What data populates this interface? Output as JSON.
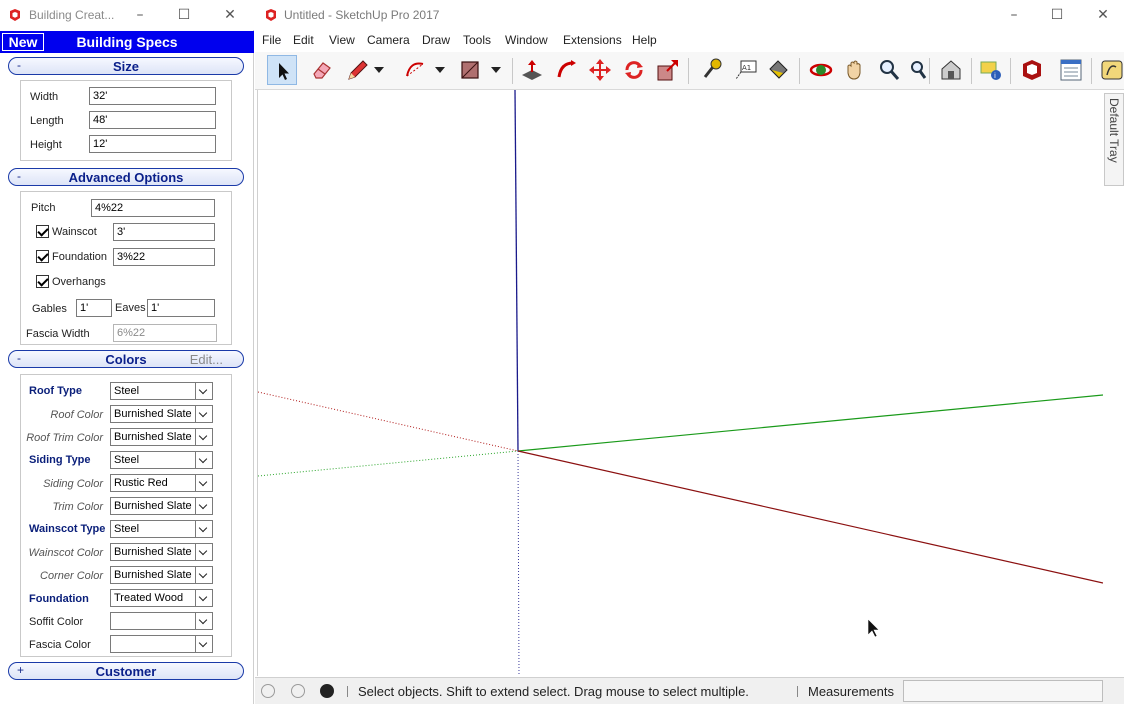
{
  "left_window": {
    "title": "Building Creat...",
    "new_button": "New",
    "header_title": "Building Specs",
    "size_section": {
      "toggle": "-",
      "title": "Size",
      "fields": [
        {
          "label": "Width",
          "value": "32'"
        },
        {
          "label": "Length",
          "value": "48'"
        },
        {
          "label": "Height",
          "value": "12'"
        }
      ]
    },
    "advanced_section": {
      "toggle": "-",
      "title": "Advanced Options",
      "pitch_label": "Pitch",
      "pitch_value": "4%22",
      "wainscot_label": "Wainscot",
      "wainscot_checked": true,
      "wainscot_value": "3'",
      "foundation_label": "Foundation",
      "foundation_checked": true,
      "foundation_value": "3%22",
      "overhangs_label": "Overhangs",
      "overhangs_checked": true,
      "gables_label": "Gables",
      "gables_value": "1'",
      "eaves_label": "Eaves",
      "eaves_value": "1'",
      "fascia_width_label": "Fascia Width",
      "fascia_width_value": "6%22"
    },
    "colors_section": {
      "toggle": "-",
      "title": "Colors",
      "edit_label": "Edit...",
      "rows": [
        {
          "label": "Roof Type",
          "style": "main",
          "value": "Steel"
        },
        {
          "label": "Roof Color",
          "style": "sub",
          "value": "Burnished Slate"
        },
        {
          "label": "Roof Trim Color",
          "style": "sub",
          "value": "Burnished Slate"
        },
        {
          "label": "Siding Type",
          "style": "main",
          "value": "Steel"
        },
        {
          "label": "Siding Color",
          "style": "sub",
          "value": "Rustic Red"
        },
        {
          "label": "Trim Color",
          "style": "sub",
          "value": "Burnished Slate"
        },
        {
          "label": "Wainscot Type",
          "style": "main",
          "value": "Steel"
        },
        {
          "label": "Wainscot Color",
          "style": "sub",
          "value": "Burnished Slate"
        },
        {
          "label": "Corner Color",
          "style": "sub",
          "value": "Burnished Slate"
        },
        {
          "label": "Foundation",
          "style": "main",
          "value": "Treated Wood"
        },
        {
          "label": "Soffit Color",
          "style": "plain",
          "value": ""
        },
        {
          "label": "Fascia Color",
          "style": "plain",
          "value": ""
        }
      ]
    },
    "customer_section": {
      "toggle": "+",
      "title": "Customer"
    }
  },
  "sketchup_window": {
    "title": "Untitled - SketchUp Pro 2017",
    "menu": [
      "File",
      "Edit",
      "View",
      "Camera",
      "Draw",
      "Tools",
      "Window",
      "Extensions",
      "Help"
    ],
    "toolbar_icons": [
      "select-icon",
      "eraser-icon",
      "pencil-icon",
      "arc-icon",
      "rectangle-icon",
      "push-pull-icon",
      "follow-me-icon",
      "move-icon",
      "rotate-icon",
      "scale-icon",
      "tape-measure-icon",
      "text-icon",
      "paint-bucket-icon",
      "orbit-icon",
      "pan-icon",
      "zoom-icon",
      "zoom-extents-icon",
      "warehouse-icon",
      "extension-warehouse-icon",
      "ruby-icon",
      "outliner-icon",
      "sandbox-icon"
    ],
    "tray_tab": "Default Tray",
    "status_text": "Select objects. Shift to extend select. Drag mouse to select multiple.",
    "measurements_label": "Measurements",
    "measurements_value": ""
  },
  "colors": {
    "accent_blue": "#0000ee",
    "axis_red": "#8b0000",
    "axis_green": "#008000",
    "axis_blue": "#00008b"
  }
}
